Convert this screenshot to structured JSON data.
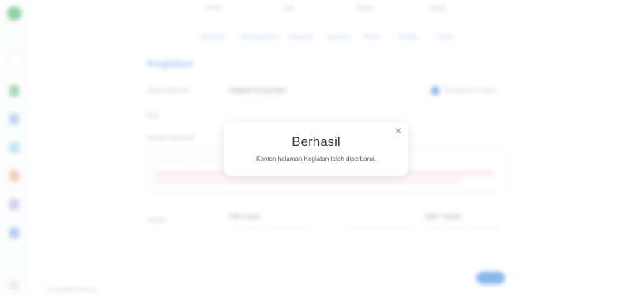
{
  "background": {
    "topbar": [
      "Profil",
      "Info",
      "Berita",
      "Galeri"
    ],
    "tabs": [
      "Beranda",
      "Tentang Kami",
      "Kegiatan",
      "Layanan",
      "Berita",
      "Kontak",
      "Galeri"
    ],
    "page_title": "Kegiatan",
    "form": {
      "title_label": "Judul Halaman",
      "title_value": "Kegiatan Komunitas",
      "toggle_text": "Tampilkan di menu",
      "icon_label": "Ikon",
      "content_label": "Konten Halaman",
      "order_label": "Urutan",
      "order_value": "Pilih urutan",
      "status_value": "Aktif / Tampil"
    },
    "save_label": "Simpan",
    "footer": "© Dashboard Admin"
  },
  "modal": {
    "title": "Berhasil",
    "message": "Konten halaman Kegiatan telah diperbarui.",
    "close_icon": "close-icon"
  }
}
